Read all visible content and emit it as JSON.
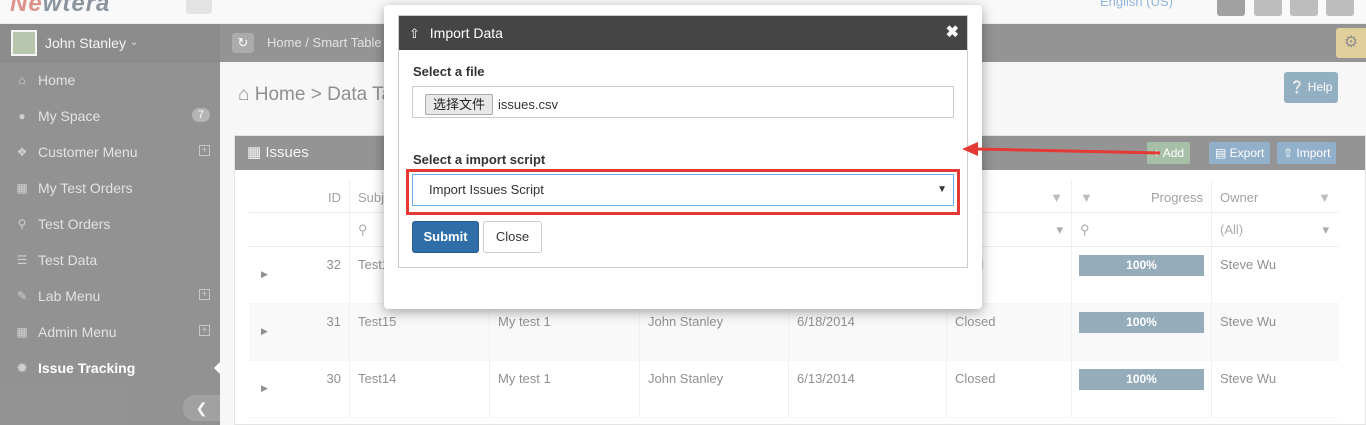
{
  "header": {
    "logo_main": "Ne",
    "logo_tail": "wtera",
    "language": "English (US)"
  },
  "sidebar": {
    "user_name": "John Stanley",
    "items": [
      {
        "label": "Home",
        "icon": "home-icon"
      },
      {
        "label": "My Space",
        "icon": "user-icon",
        "badge": "7"
      },
      {
        "label": "Customer Menu",
        "icon": "puzzle-icon",
        "expandable": true
      },
      {
        "label": "My Test Orders",
        "icon": "grid-icon"
      },
      {
        "label": "Test Orders",
        "icon": "search-icon"
      },
      {
        "label": "Test Data",
        "icon": "database-icon"
      },
      {
        "label": "Lab Menu",
        "icon": "edit-icon",
        "expandable": true
      },
      {
        "label": "Admin Menu",
        "icon": "building-icon",
        "expandable": true
      },
      {
        "label": "Issue Tracking",
        "icon": "bug-icon",
        "active": true
      }
    ]
  },
  "breadcrumb": {
    "home": "Home /",
    "current": "Smart Table"
  },
  "page": {
    "title_home": "Home",
    "title_rest": "> Data Ta",
    "help_label": "Help"
  },
  "panel": {
    "title": "Issues",
    "add_label": "Add",
    "export_label": "Export",
    "import_label": "Import"
  },
  "grid": {
    "headers": {
      "id": "ID",
      "subject": "Subj",
      "status": "s",
      "progress": "Progress",
      "owner": "Owner"
    },
    "owner_filter": "(All)",
    "rows": [
      {
        "id": "32",
        "subject": "Test1",
        "desc": "",
        "reporter": "",
        "date": "",
        "status": "osed",
        "progress": "100%",
        "owner": "Steve Wu"
      },
      {
        "id": "31",
        "subject": "Test15",
        "desc": "My test 1",
        "reporter": "John Stanley",
        "date": "6/18/2014",
        "status": "Closed",
        "progress": "100%",
        "owner": "Steve Wu"
      },
      {
        "id": "30",
        "subject": "Test14",
        "desc": "My test 1",
        "reporter": "John Stanley",
        "date": "6/13/2014",
        "status": "Closed",
        "progress": "100%",
        "owner": "Steve Wu"
      }
    ]
  },
  "modal": {
    "title": "Import Data",
    "file_label": "Select a file",
    "file_button": "选择文件",
    "file_name": "issues.csv",
    "script_label": "Select a import script",
    "script_value": "Import Issues Script",
    "submit_label": "Submit",
    "close_label": "Close"
  },
  "colors": {
    "sidebar_bg": "#3a3a3a",
    "accent_blue": "#2f6ea8",
    "highlight_red": "#e53935",
    "progress_fill": "#3e6a82"
  }
}
